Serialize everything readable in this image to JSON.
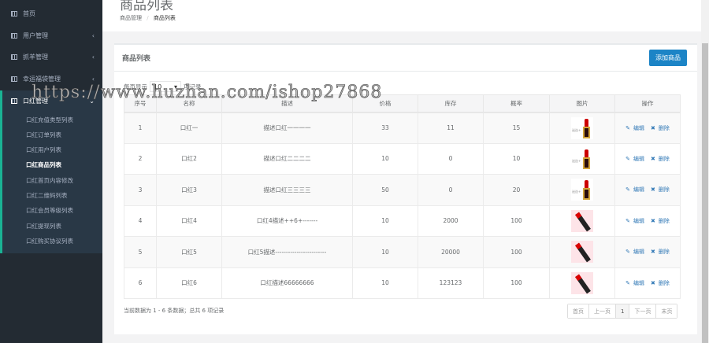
{
  "sidebar": {
    "items": [
      {
        "label": "首页",
        "chevron": ""
      },
      {
        "label": "用户管理",
        "chevron": "‹"
      },
      {
        "label": "抓羊管理",
        "chevron": "‹"
      },
      {
        "label": "幸运福袋管理",
        "chevron": "‹"
      },
      {
        "label": "口红管理",
        "chevron": "⌄"
      }
    ],
    "sub_items": [
      "口红充值类型列表",
      "口红订单列表",
      "口红用户列表",
      "口红商品列表",
      "口红首页内容修改",
      "口红二维码列表",
      "口红会员等级列表",
      "口红提现列表",
      "口红购买协议列表"
    ],
    "active_sub": "口红商品列表"
  },
  "header": {
    "title": "商品列表",
    "breadcrumb": [
      "商品管理",
      "商品列表"
    ],
    "separator": "/"
  },
  "card": {
    "title": "商品列表",
    "add_button": "添加商品",
    "length": {
      "prefix": "每页显示",
      "value": "10",
      "suffix": "项记录"
    },
    "columns": [
      "序号",
      "名称",
      "描述",
      "价格",
      "库存",
      "概率",
      "图片",
      "操作"
    ],
    "rows": [
      {
        "id": "1",
        "name": "口红一",
        "desc": "描述口红一一一一",
        "price": "33",
        "stock": "11",
        "prob": "15",
        "img": "gold",
        "edit": "编辑",
        "del": "删除"
      },
      {
        "id": "2",
        "name": "口红2",
        "desc": "描述口红二二二二",
        "price": "10",
        "stock": "0",
        "prob": "10",
        "img": "gold",
        "edit": "编辑",
        "del": "删除"
      },
      {
        "id": "3",
        "name": "口红3",
        "desc": "描述口红三三三三",
        "price": "50",
        "stock": "0",
        "prob": "20",
        "img": "gold",
        "edit": "编辑",
        "del": "删除"
      },
      {
        "id": "4",
        "name": "口红4",
        "desc": "口红4描述++6+-------",
        "price": "10",
        "stock": "2000",
        "prob": "100",
        "img": "pink",
        "edit": "编辑",
        "del": "删除"
      },
      {
        "id": "5",
        "name": "口红5",
        "desc": "口红5描述------------------------",
        "price": "10",
        "stock": "20000",
        "prob": "100",
        "img": "pink",
        "edit": "编辑",
        "del": "删除"
      },
      {
        "id": "6",
        "name": "口红6",
        "desc": "口红描述66666666",
        "price": "10",
        "stock": "123123",
        "prob": "100",
        "img": "pink",
        "edit": "编辑",
        "del": "删除"
      }
    ],
    "img_label": "迷迭+",
    "info": "当前数据为 1 - 6 条数据；总共 6 项记录",
    "pager": [
      "首页",
      "上一页",
      "1",
      "下一页",
      "末页"
    ]
  },
  "watermark": "https://www.huzhan.com/ishop27868",
  "colors": {
    "sidebar": "#232b33",
    "accent": "#1ab394",
    "primary": "#1c84c6"
  }
}
